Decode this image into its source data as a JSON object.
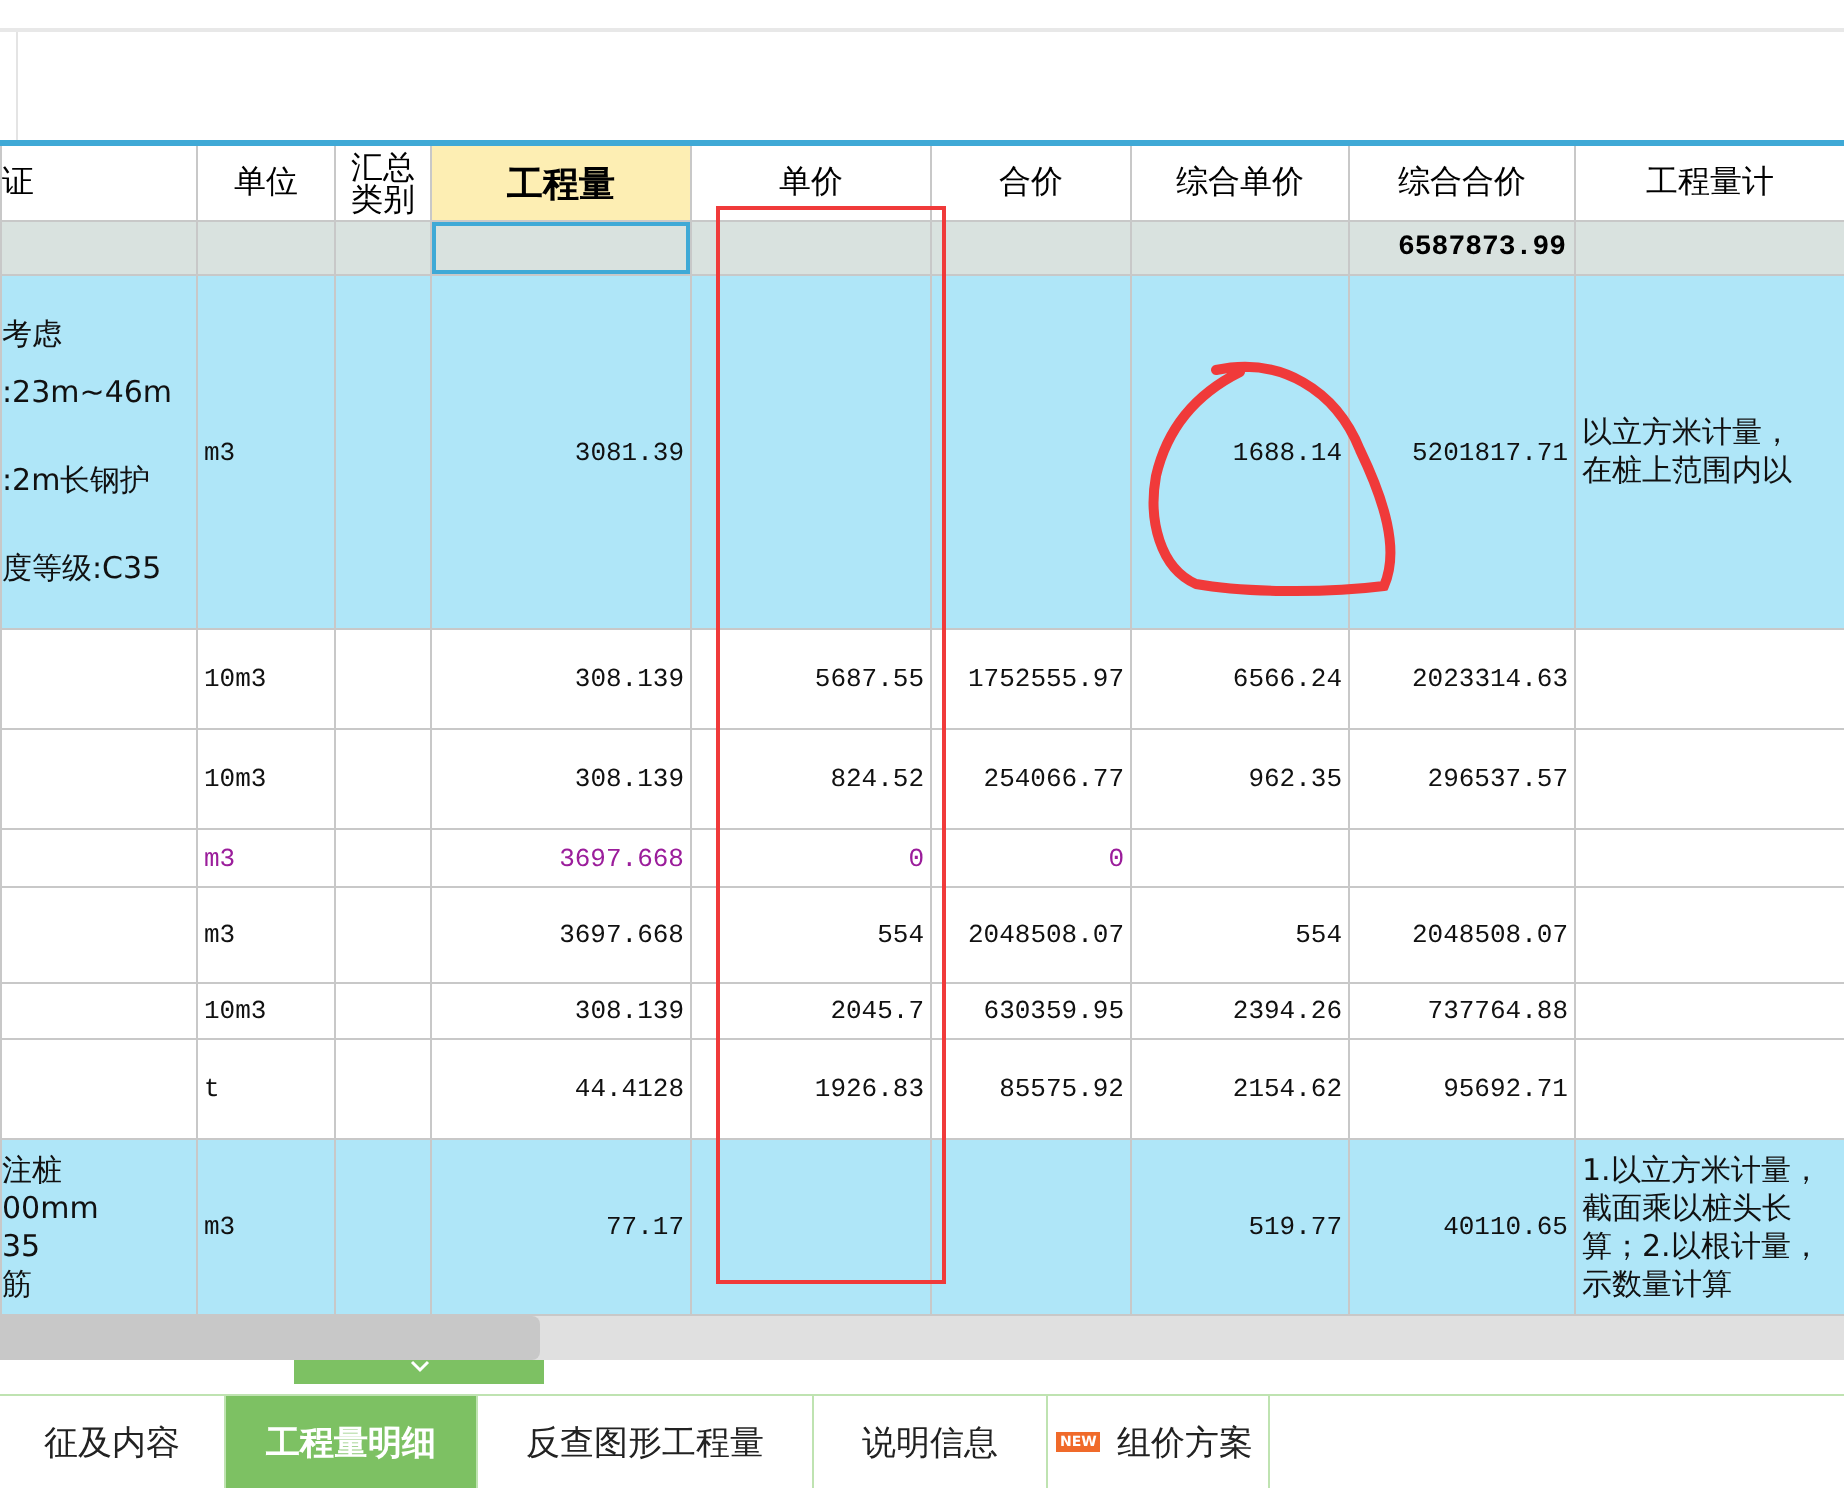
{
  "table": {
    "columns": [
      {
        "label": "证",
        "highlighted": false
      },
      {
        "label": "单位",
        "highlighted": false
      },
      {
        "label": [
          "汇总",
          "类别"
        ],
        "highlighted": false
      },
      {
        "label": "工程量",
        "highlighted": true
      },
      {
        "label": "单价",
        "highlighted": false
      },
      {
        "label": "合价",
        "highlighted": false
      },
      {
        "label": "综合单价",
        "highlighted": false
      },
      {
        "label": "综合合价",
        "highlighted": false
      },
      {
        "label": "工程量计",
        "highlighted": false
      }
    ],
    "total_row": {
      "cells": [
        "",
        "",
        "",
        "",
        "",
        "",
        "",
        "6587873.99",
        ""
      ],
      "selected": [
        false,
        false,
        false,
        true,
        false,
        false,
        false,
        false,
        false
      ]
    },
    "rows": [
      {
        "kind": "main",
        "cells": [
          [
            "考虑",
            ":23m~46m",
            "",
            ":2m长钢护",
            "",
            "度等级:C35"
          ],
          "m3",
          "",
          "3081.39",
          "",
          "",
          "1688.14",
          "5201817.71",
          [
            "以立方米计量，",
            "在桩上范围内以"
          ]
        ]
      },
      {
        "kind": "item",
        "cells": [
          "",
          "10m3",
          "",
          "308.139",
          "5687.55",
          "1752555.97",
          "6566.24",
          "2023314.63",
          ""
        ]
      },
      {
        "kind": "item",
        "cells": [
          "",
          "10m3",
          "",
          "308.139",
          "824.52",
          "254066.77",
          "962.35",
          "296537.57",
          ""
        ]
      },
      {
        "kind": "material",
        "cells": [
          "",
          "m3",
          "",
          "3697.668",
          "0",
          "0",
          "",
          "",
          ""
        ]
      },
      {
        "kind": "item",
        "cells": [
          "",
          "m3",
          "",
          "3697.668",
          "554",
          "2048508.07",
          "554",
          "2048508.07",
          ""
        ]
      },
      {
        "kind": "item",
        "cells": [
          "",
          "10m3",
          "",
          "308.139",
          "2045.7",
          "630359.95",
          "2394.26",
          "737764.88",
          ""
        ]
      },
      {
        "kind": "item",
        "cells": [
          "",
          "t",
          "",
          "44.4128",
          "1926.83",
          "85575.92",
          "2154.62",
          "95692.71",
          ""
        ]
      },
      {
        "kind": "main",
        "cells": [
          [
            "注桩",
            "00mm",
            "35",
            "筋"
          ],
          "m3",
          "",
          "77.17",
          "",
          "",
          "519.77",
          "40110.65",
          [
            "1.以立方米计量，",
            "截面乘以桩头长",
            "算；2.以根计量，",
            "示数量计算"
          ]
        ]
      }
    ]
  },
  "tabs": [
    {
      "label": "征及内容",
      "selected": false
    },
    {
      "label": "工程量明细",
      "selected": true
    },
    {
      "label": "反查图形工程量",
      "selected": false
    },
    {
      "label": "说明信息",
      "selected": false
    },
    {
      "label": "组价方案",
      "selected": false,
      "badge": "NEW"
    }
  ]
}
